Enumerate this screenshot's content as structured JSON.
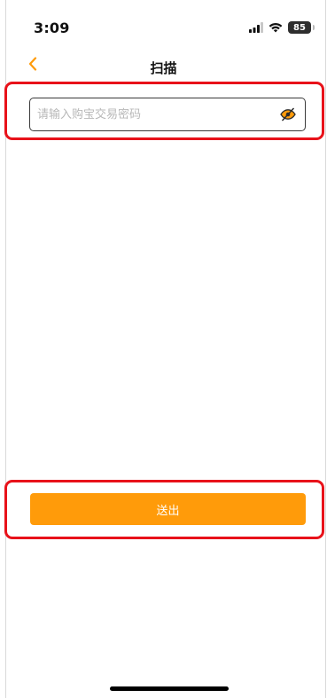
{
  "status_bar": {
    "time": "3:09",
    "battery": "85"
  },
  "nav": {
    "title": "扫描",
    "back_icon": "chevron-left-icon"
  },
  "password": {
    "placeholder": "请输入购宝交易密码",
    "value": "",
    "toggle_icon": "eye-hidden-icon"
  },
  "actions": {
    "submit_label": "送出"
  },
  "colors": {
    "accent": "#ff9b0a",
    "highlight": "#e8121a",
    "border": "#3a3a3a",
    "placeholder": "#b8b8b8"
  }
}
